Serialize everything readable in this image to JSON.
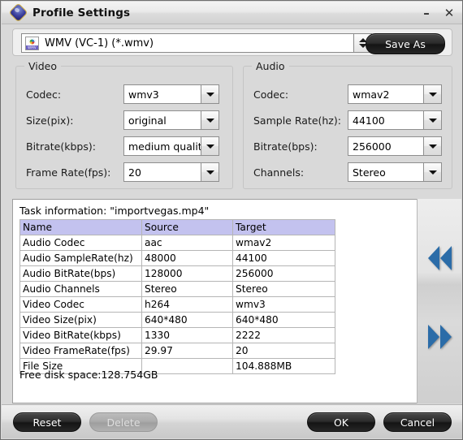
{
  "window": {
    "title": "Profile Settings",
    "app_icon": "shield-diamond-icon",
    "minimize_label": "–",
    "close_label": "✕"
  },
  "format_bar": {
    "format_icon": "wmv-file-icon",
    "format_icon_label": "WMV",
    "selected_format": "WMV (VC-1) (*.wmv)",
    "spinner_icon": "up-down-spinner-icon",
    "save_as_label": "Save As"
  },
  "video": {
    "group_title": "Video",
    "fields": [
      {
        "label": "Codec:",
        "value": "wmv3"
      },
      {
        "label": "Size(pix):",
        "value": "original"
      },
      {
        "label": "Bitrate(kbps):",
        "value": "medium quality"
      },
      {
        "label": "Frame Rate(fps):",
        "value": "20"
      }
    ]
  },
  "audio": {
    "group_title": "Audio",
    "fields": [
      {
        "label": "Codec:",
        "value": "wmav2"
      },
      {
        "label": "Sample Rate(hz):",
        "value": "44100"
      },
      {
        "label": "Bitrate(bps):",
        "value": "256000"
      },
      {
        "label": "Channels:",
        "value": "Stereo"
      }
    ]
  },
  "task_info": {
    "heading": "Task information: \"importvegas.mp4\"",
    "columns": [
      "Name",
      "Source",
      "Target"
    ],
    "rows": [
      [
        "Audio Codec",
        "aac",
        "wmav2"
      ],
      [
        "Audio SampleRate(hz)",
        "48000",
        "44100"
      ],
      [
        "Audio BitRate(bps)",
        "128000",
        "256000"
      ],
      [
        "Audio Channels",
        "Stereo",
        "Stereo"
      ],
      [
        "Video Codec",
        "h264",
        "wmv3"
      ],
      [
        "Video Size(pix)",
        "640*480",
        "640*480"
      ],
      [
        "Video BitRate(kbps)",
        "1330",
        "2222"
      ],
      [
        "Video FrameRate(fps)",
        "29.97",
        "20"
      ],
      [
        "File Size",
        "",
        "104.888MB"
      ]
    ],
    "free_space": "Free disk space:128.754GB",
    "header_color": "#c3c2ef"
  },
  "nav_strip": {
    "prev_icon": "rewind-double-arrow-icon",
    "next_icon": "fast-forward-double-arrow-icon",
    "arrow_color": "#2b6ca8"
  },
  "footer": {
    "reset_label": "Reset",
    "delete_label": "Delete",
    "ok_label": "OK",
    "cancel_label": "Cancel"
  }
}
